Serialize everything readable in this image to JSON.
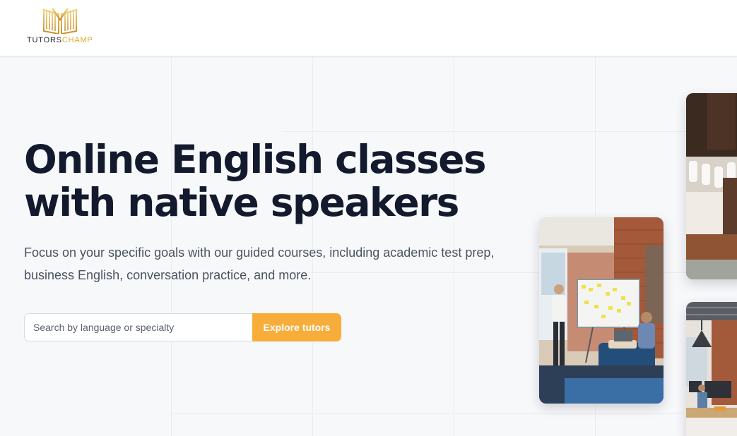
{
  "header": {
    "logo": {
      "icon": "open-book-crown-icon",
      "text_part1": "TUTORS",
      "text_part2": "CHAMP",
      "brand_color": "#e0a92b"
    }
  },
  "hero": {
    "title_line1": "Online English classes",
    "title_line2": "with native speakers",
    "subtitle": "Focus on your specific goals with our guided courses, including academic test prep, business English, conversation practice, and more."
  },
  "search": {
    "placeholder": "Search by language or specialty",
    "value": "",
    "button_label": "Explore tutors",
    "accent_color": "#f8ad3a"
  },
  "images": [
    {
      "name": "classroom-whiteboard-photo"
    },
    {
      "name": "student-workspace-photo"
    },
    {
      "name": "office-workspace-photo"
    }
  ]
}
